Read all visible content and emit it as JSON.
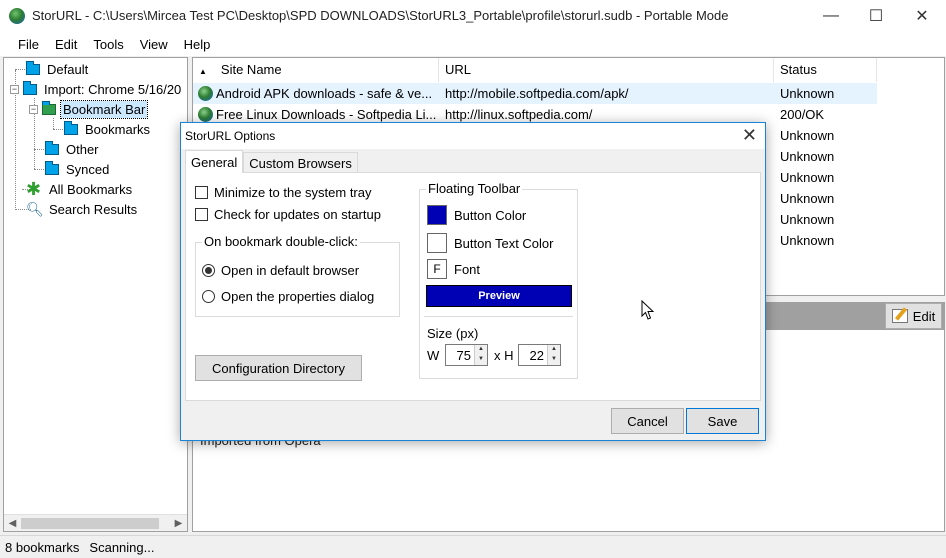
{
  "window": {
    "title": "StorURL - C:\\Users\\Mircea Test PC\\Desktop\\SPD DOWNLOADS\\StorURL3_Portable\\profile\\storurl.sudb - Portable Mode",
    "minimize": "—",
    "maximize": "☐",
    "close": "✕"
  },
  "menu": [
    "File",
    "Edit",
    "Tools",
    "View",
    "Help"
  ],
  "tree": {
    "items": [
      {
        "label": "Default"
      },
      {
        "label": "Import: Chrome 5/16/20"
      },
      {
        "label": "Bookmark Bar"
      },
      {
        "label": "Bookmarks"
      },
      {
        "label": "Other"
      },
      {
        "label": "Synced"
      },
      {
        "label": "All Bookmarks"
      },
      {
        "label": "Search Results"
      }
    ],
    "expand_minus": "−"
  },
  "list": {
    "sort_arrow": "▲",
    "columns": [
      "Site Name",
      "URL",
      "Status"
    ],
    "rows": [
      {
        "name": "Android APK downloads - safe & ve...",
        "url": "http://mobile.softpedia.com/apk/",
        "status": "Unknown"
      },
      {
        "name": "Free Linux Downloads - Softpedia Li...",
        "url": "http://linux.softpedia.com/",
        "status": "200/OK"
      },
      {
        "name": "",
        "url": "",
        "status": "Unknown"
      },
      {
        "name": "",
        "url": "",
        "status": "Unknown"
      },
      {
        "name": "",
        "url": "",
        "status": "Unknown"
      },
      {
        "name": "",
        "url": "",
        "status": "Unknown"
      },
      {
        "name": "",
        "url": "",
        "status": "Unknown"
      },
      {
        "name": "",
        "url": "",
        "status": "Unknown"
      }
    ]
  },
  "details": {
    "edit_label": "Edit",
    "text": "Imported from Opera"
  },
  "status": {
    "count": "8 bookmarks",
    "activity": "Scanning..."
  },
  "dialog": {
    "title": "StorURL Options",
    "close": "✕",
    "tabs": [
      "General",
      "Custom Browsers"
    ],
    "minimize_tray": "Minimize to the system tray",
    "check_updates": "Check for updates on startup",
    "double_click_group": "On bookmark double-click:",
    "open_default": "Open in default browser",
    "open_properties": "Open the properties dialog",
    "config_dir": "Configuration Directory",
    "floating_toolbar": "Floating Toolbar",
    "button_color": "Button Color",
    "button_text_color": "Button Text Color",
    "font_glyph": "F",
    "font": "Font",
    "preview": "Preview",
    "size_label": "Size (px)",
    "w_label": "W",
    "x_label": "x H",
    "width": "75",
    "height": "22",
    "cancel": "Cancel",
    "save": "Save",
    "colors": {
      "button": "#0000b4",
      "text": "#ffffff"
    }
  }
}
